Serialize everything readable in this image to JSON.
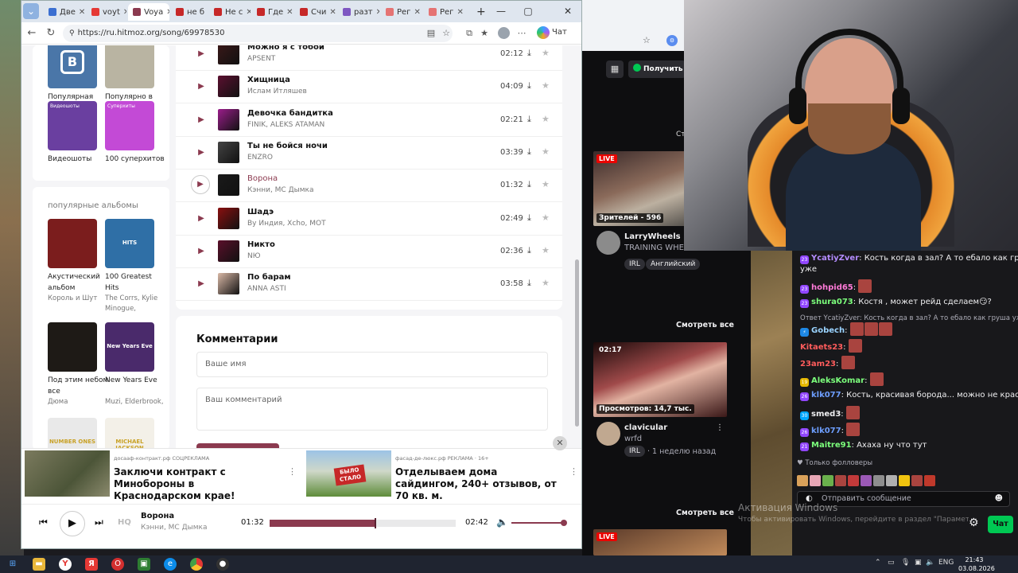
{
  "browser": {
    "tabs": [
      {
        "label": "Две",
        "color": "#3b6fd1"
      },
      {
        "label": "voyt",
        "color": "#e53935"
      },
      {
        "label": "Voya",
        "color": "#8b3a4f",
        "active": true
      },
      {
        "label": "не б",
        "color": "#c62828"
      },
      {
        "label": "Не с",
        "color": "#c62828"
      },
      {
        "label": "Где",
        "color": "#c62828"
      },
      {
        "label": "Счи",
        "color": "#c62828"
      },
      {
        "label": "разт",
        "color": "#7e57c2"
      },
      {
        "label": "Рег",
        "color": "#e57373"
      },
      {
        "label": "Рег",
        "color": "#e57373"
      }
    ],
    "new_tab": "+",
    "url": "https://ru.hitmoz.org/song/69978530",
    "chat_label": "Чат",
    "window_controls": {
      "minimize": "—",
      "maximize": "▢",
      "close": "✕"
    }
  },
  "sidebar": {
    "top_tiles": [
      {
        "label": "Популярная музыка ВК",
        "icon": "vk-logo",
        "bg": "#4a76a8"
      },
      {
        "label": "Популярно в Москве",
        "icon": "moscow-photo",
        "bg": "#b9b4a2"
      },
      {
        "label": "Видеошоты",
        "icon": "videoshots-cover",
        "bg": "#6a3fa0",
        "overlay": "Видеошоты"
      },
      {
        "label": "100 суперхитов",
        "icon": "superhits-cover",
        "bg": "#c34ad6",
        "overlay": "Суперхиты"
      }
    ],
    "albums_heading": "популярные альбомы",
    "albums": [
      {
        "title": "Акустический альбом",
        "artist": "Король и Шут",
        "bg": "#7b1d1d"
      },
      {
        "title": "100 Greatest Hits",
        "artist": "The Corrs, Kylie Minogue,",
        "bg": "#2f6fa6",
        "overlay": "HITS"
      },
      {
        "title": "Под этим небом все",
        "artist": "Дюма",
        "bg": "#1e1a16"
      },
      {
        "title": "New Years Eve",
        "artist": "Muzi, Elderbrook,",
        "bg": "#4a2a6b",
        "overlay": "New Years Eve"
      },
      {
        "title": "",
        "artist": "",
        "bg": "#e9e9e9",
        "overlay": "NUMBER ONES"
      },
      {
        "title": "",
        "artist": "",
        "bg": "#f3f0e8",
        "overlay": "MICHAEL JACKSON"
      }
    ]
  },
  "tracks": [
    {
      "title": "Можно я с тобой",
      "artist": "APSENT",
      "duration": "02:12",
      "cover": "#3a1818"
    },
    {
      "title": "Хищница",
      "artist": "Ислам Итляшев",
      "duration": "04:09",
      "cover": "#5b1030"
    },
    {
      "title": "Девочка бандитка",
      "artist": "FINIK, ALEKS ATAMAN",
      "duration": "02:21",
      "cover": "#9b1d8b"
    },
    {
      "title": "Ты не бойся ночи",
      "artist": "ENZRO",
      "duration": "03:39",
      "cover": "#444444"
    },
    {
      "title": "Ворона",
      "artist": "Кэнни, МС Дымка",
      "duration": "01:32",
      "cover": "#1a1a1a",
      "current": true
    },
    {
      "title": "Шадэ",
      "artist": "By Индия, Xcho, MOT",
      "duration": "02:49",
      "cover": "#8a1010"
    },
    {
      "title": "Никто",
      "artist": "NЮ",
      "duration": "02:36",
      "cover": "#5a0f2a"
    },
    {
      "title": "По барам",
      "artist": "ANNA ASTI",
      "duration": "03:58",
      "cover": "#d9b8a6"
    }
  ],
  "comments": {
    "title": "Комментарии",
    "name_placeholder": "Ваше имя",
    "comment_placeholder": "Ваш комментарий"
  },
  "ads": [
    {
      "source": "досааф-контракт.рф  СОЦРЕКЛАМА",
      "title": "Заключи контракт с Минобороны в Краснодарском крае!",
      "more": "⋮"
    },
    {
      "source": "фасад-де-люкс.рф  РЕКЛАМА · 16+",
      "title": "Отделываем дома сайдингом, 240+ отзывов, от 70 кв. м.",
      "more": "⋮",
      "overlay": "БЫЛО СТАЛО"
    }
  ],
  "player": {
    "quality": "HQ",
    "title": "Ворона",
    "artist": "Кэнни, МС Дымка",
    "current_time": "01:32",
    "total_time": "02:42",
    "progress": 0.57,
    "volume": 1.0
  },
  "twitch": {
    "get_label": "Получить",
    "cr_label": "Ст",
    "see_all": "Смотреть все",
    "stream1": {
      "live": "LIVE",
      "viewers": "Зрителей - 596",
      "name": "LarryWheels",
      "title": "TRAINING WHEELS...",
      "tags": [
        "IRL",
        "Английский"
      ]
    },
    "stream2": {
      "duration": "02:17",
      "views": "Просмотров: 14,7 тыс.",
      "name": "clavicular",
      "title": "wrfd",
      "tag": "IRL",
      "meta": "· 1 неделю назад"
    },
    "stream3": {
      "live": "LIVE"
    }
  },
  "chat": {
    "messages": [
      {
        "badge": "23",
        "badge_color": "#9146ff",
        "user": "YcatiyZver",
        "color": "#b48cff",
        "text": ": Кость когда в зал? А то ебало как груша",
        "cont": "уже"
      },
      {
        "badge": "23",
        "badge_color": "#9146ff",
        "user": "hohpid65",
        "color": "#ff7ad8",
        "text": ": ",
        "emotes": 1
      },
      {
        "badge": "23",
        "badge_color": "#9146ff",
        "user": "shura073",
        "color": "#7cff7c",
        "text": ": Костя , может рейд сделаем😏?"
      },
      {
        "reply": "Ответ YcatiyZver: Кость когда в зал? А то ебало как груша уже"
      },
      {
        "badge": "⚡",
        "badge_color": "#1e88e5",
        "user": "Gobech",
        "color": "#9ad3ff",
        "text": ": ",
        "emotes": 3
      },
      {
        "user": "Kitaets23",
        "color": "#ff5c5c",
        "text": ": ",
        "emotes": 1
      },
      {
        "user": "23am23",
        "color": "#ff5c5c",
        "text": ": ",
        "emotes": 1
      },
      {
        "badge": "19",
        "badge_color": "#e6b800",
        "user": "AleksKomar",
        "color": "#7cff7c",
        "text": ": ",
        "emotes": 1
      },
      {
        "badge": "26",
        "badge_color": "#9146ff",
        "user": "klk077",
        "color": "#6d9eff",
        "text": ": Кость, красивая борода... можно не красить"
      },
      {
        "badge": "30",
        "badge_color": "#00a6ff",
        "user": "smed3",
        "color": "#efeff1",
        "text": ": ",
        "emotes": 1
      },
      {
        "badge": "26",
        "badge_color": "#9146ff",
        "user": "klk077",
        "color": "#6d9eff",
        "text": ": ",
        "emotes": 1
      },
      {
        "badge": "21",
        "badge_color": "#9146ff",
        "user": "Maitre91",
        "color": "#7cff7c",
        "text": ": Ахаха ну что тут"
      }
    ],
    "followers_only": "♥ Только фолловеры",
    "input_placeholder": "Отправить сообщение",
    "send_label": "Чат"
  },
  "watermark": {
    "title": "Активация Windows",
    "subtitle": "Чтобы активировать Windows, перейдите в раздел \"Параметры\"."
  },
  "taskbar": {
    "lang": "ENG",
    "time": "21:43",
    "date": "03.08.2026"
  }
}
